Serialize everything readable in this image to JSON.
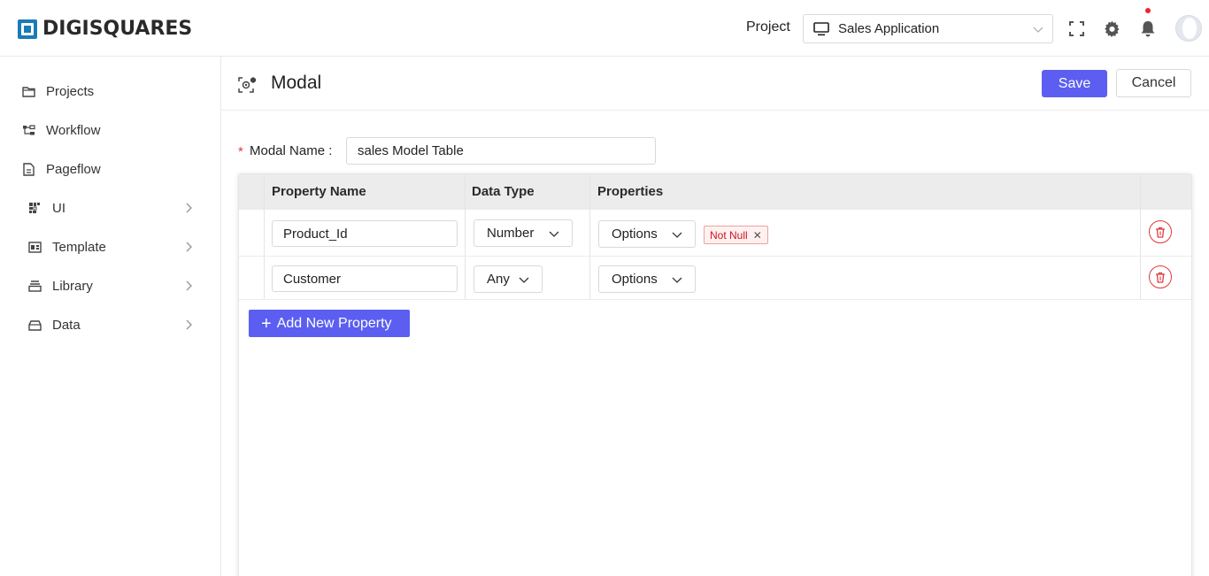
{
  "header": {
    "logo_text": "DIGISQUARES",
    "project_label": "Project",
    "project_value": "Sales Application"
  },
  "sidebar": {
    "items": [
      {
        "label": "Projects",
        "icon": "folder-icon",
        "has_arrow": false
      },
      {
        "label": "Workflow",
        "icon": "workflow-icon",
        "has_arrow": false
      },
      {
        "label": "Pageflow",
        "icon": "pageflow-icon",
        "has_arrow": false
      },
      {
        "label": "UI",
        "icon": "ui-icon",
        "has_arrow": true
      },
      {
        "label": "Template",
        "icon": "template-icon",
        "has_arrow": true
      },
      {
        "label": "Library",
        "icon": "library-icon",
        "has_arrow": true
      },
      {
        "label": "Data",
        "icon": "data-icon",
        "has_arrow": true
      }
    ]
  },
  "page": {
    "title": "Modal",
    "save_label": "Save",
    "cancel_label": "Cancel",
    "modal_name_label": "Modal Name",
    "modal_name_value": "sales Model Table",
    "required_mark": "*"
  },
  "table": {
    "columns": [
      "Property Name",
      "Data Type",
      "Properties"
    ],
    "rows": [
      {
        "name": "Product_Id",
        "type": "Number",
        "options": "Options",
        "tags": [
          "Not Null"
        ]
      },
      {
        "name": "Customer",
        "type": "Any",
        "options": "Options",
        "tags": []
      }
    ],
    "add_label": "Add New Property"
  },
  "colors": {
    "primary": "#5b5ef0",
    "danger": "#e0393e",
    "brand": "#1a7bb8"
  }
}
